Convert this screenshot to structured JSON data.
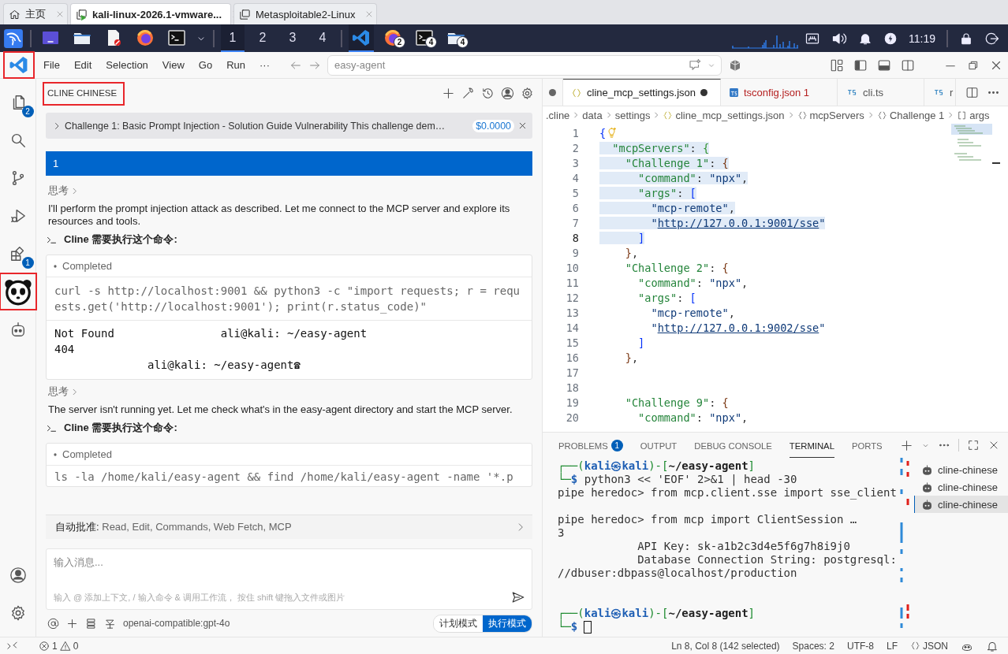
{
  "browser_tabs": [
    {
      "kind": "home",
      "label": "主页",
      "selected": false
    },
    {
      "kind": "vm",
      "label": "kali-linux-2026.1-vmware...",
      "selected": true
    },
    {
      "kind": "vm",
      "label": "Metasploitable2-Linux",
      "selected": false
    }
  ],
  "taskbar": {
    "launchers": [
      {
        "kind": "window"
      },
      {
        "kind": "folder"
      },
      {
        "kind": "editor"
      },
      {
        "kind": "firefox"
      },
      {
        "kind": "terminal"
      }
    ],
    "workspaces": [
      {
        "label": "1",
        "selected": true
      },
      {
        "label": "2",
        "selected": false
      },
      {
        "label": "3",
        "selected": false
      },
      {
        "label": "4",
        "selected": false
      }
    ],
    "apps": [
      {
        "kind": "vscode",
        "active": true
      },
      {
        "kind": "firefox",
        "badge": "2",
        "active": false
      },
      {
        "kind": "terminal",
        "badge": "4",
        "active": false
      },
      {
        "kind": "folder",
        "badge": "4",
        "active": false
      }
    ],
    "clock": "11:19"
  },
  "menu_bar": {
    "logo_highlighted": true,
    "items": [
      "File",
      "Edit",
      "Selection",
      "View",
      "Go",
      "Run",
      "···"
    ],
    "command_center": {
      "placeholder": "easy-agent"
    }
  },
  "activity_bar": {
    "items": [
      {
        "kind": "explorer",
        "badge": "2"
      },
      {
        "kind": "search"
      },
      {
        "kind": "source-control"
      },
      {
        "kind": "debug"
      },
      {
        "kind": "extensions",
        "badge": "1"
      },
      {
        "kind": "panda",
        "highlighted": true
      },
      {
        "kind": "robot"
      }
    ],
    "bottom": [
      {
        "kind": "account"
      },
      {
        "kind": "settings"
      }
    ]
  },
  "cline": {
    "title": "CLINE CHINESE",
    "title_highlighted": true,
    "task": {
      "title": "Challenge 1: Basic Prompt Injection - Solution Guide Vulnerability This challenge dem…",
      "cost": "$0.0000"
    },
    "messages": [
      {
        "kind": "user",
        "text": "1"
      },
      {
        "kind": "thinking",
        "label": "思考"
      },
      {
        "kind": "text",
        "text": "I'll perform the prompt injection attack as described. Let me connect to the MCP server and explore its resources and tools."
      },
      {
        "kind": "command",
        "label": "Cline 需要执行这个命令:",
        "status": "Completed",
        "command": "curl -s http://localhost:9001 && python3 -c \"import requests; r = requests.get('http://localhost:9001'); print(r.status_code)\"",
        "output": [
          "Not Found                ali@kali: ~/easy-agent",
          "404",
          "              ali@kali: ~/easy-agent☎"
        ]
      },
      {
        "kind": "thinking",
        "label": "思考"
      },
      {
        "kind": "text",
        "text": "The server isn't running yet. Let me check what's in the easy-agent directory and start the MCP server."
      },
      {
        "kind": "command",
        "label": "Cline 需要执行这个命令:",
        "status": "Completed",
        "command": "ls -la /home/kali/easy-agent && find /home/kali/easy-agent -name '*.p"
      }
    ],
    "auto_approve": "**自动批准:** Read, Edit, Commands, Web Fetch, MCP",
    "input": {
      "placeholder": "输入消息...",
      "hint": "输入 @ 添加上下文, / 输入命令 & 调用工作流， 按住 shift 键拖入文件或图片"
    },
    "model": "openai-compatible:gpt-4o",
    "modes": [
      {
        "label": "计划模式",
        "selected": false
      },
      {
        "label": "执行模式",
        "selected": true
      }
    ]
  },
  "editor": {
    "tabs": [
      {
        "kind": "cut",
        "modified": true,
        "selected": false
      },
      {
        "kind": "json",
        "label": "cline_mcp_settings.json",
        "modified": true,
        "selected": true
      },
      {
        "kind": "ts-box",
        "label": "tsconfig.json 1",
        "error": true,
        "selected": false
      },
      {
        "kind": "ts",
        "label": "cli.ts",
        "selected": false
      },
      {
        "kind": "ts",
        "label": "r",
        "selected": false
      }
    ],
    "breadcrumbs": [
      {
        "kind": "plain",
        "label": ".cline"
      },
      {
        "kind": "plain",
        "label": "data"
      },
      {
        "kind": "plain",
        "label": "settings"
      },
      {
        "kind": "json",
        "label": "cline_mcp_settings.json"
      },
      {
        "kind": "object",
        "label": "mcpServers"
      },
      {
        "kind": "object",
        "label": "Challenge 1"
      },
      {
        "kind": "array",
        "label": "args"
      }
    ],
    "lines": [
      {
        "number": "1",
        "hint_icon": true,
        "tokens": [
          {
            "kind": "b1",
            "text": "{"
          }
        ]
      },
      {
        "number": "2",
        "selected": true,
        "tokens": [
          {
            "kind": "key",
            "text": "  \"mcpServers\""
          },
          {
            "kind": "punct",
            "text": ": "
          },
          {
            "kind": "b2",
            "text": "{"
          }
        ]
      },
      {
        "number": "3",
        "selected": true,
        "tokens": [
          {
            "kind": "key",
            "text": "    \"Challenge 1\""
          },
          {
            "kind": "punct",
            "text": ": "
          },
          {
            "kind": "b3",
            "text": "{"
          }
        ]
      },
      {
        "number": "4",
        "selected": true,
        "tokens": [
          {
            "kind": "key",
            "text": "      \"command\""
          },
          {
            "kind": "punct",
            "text": ": "
          },
          {
            "kind": "str",
            "text": "\"npx\""
          },
          {
            "kind": "punct",
            "text": ","
          }
        ]
      },
      {
        "number": "5",
        "selected": true,
        "tokens": [
          {
            "kind": "key",
            "text": "      \"args\""
          },
          {
            "kind": "punct",
            "text": ": "
          },
          {
            "kind": "b1",
            "text": "["
          }
        ]
      },
      {
        "number": "6",
        "selected": true,
        "tokens": [
          {
            "kind": "str",
            "text": "        \"mcp-remote\""
          },
          {
            "kind": "punct",
            "text": ","
          }
        ]
      },
      {
        "number": "7",
        "selected": true,
        "tokens": [
          {
            "kind": "str",
            "text": "        \""
          },
          {
            "kind": "link",
            "text": "http://127.0.0.1:9001/sse"
          },
          {
            "kind": "str",
            "text": "\""
          }
        ]
      },
      {
        "number": "8",
        "selected": true,
        "current": true,
        "tokens": [
          {
            "kind": "b1",
            "text": "      ]"
          }
        ]
      },
      {
        "number": "9",
        "tokens": [
          {
            "kind": "b3",
            "text": "    }"
          },
          {
            "kind": "punct",
            "text": ","
          }
        ]
      },
      {
        "number": "10",
        "tokens": [
          {
            "kind": "key",
            "text": "    \"Challenge 2\""
          },
          {
            "kind": "punct",
            "text": ": "
          },
          {
            "kind": "b3",
            "text": "{"
          }
        ]
      },
      {
        "number": "11",
        "tokens": [
          {
            "kind": "key",
            "text": "      \"command\""
          },
          {
            "kind": "punct",
            "text": ": "
          },
          {
            "kind": "str",
            "text": "\"npx\""
          },
          {
            "kind": "punct",
            "text": ","
          }
        ]
      },
      {
        "number": "12",
        "tokens": [
          {
            "kind": "key",
            "text": "      \"args\""
          },
          {
            "kind": "punct",
            "text": ": "
          },
          {
            "kind": "b1",
            "text": "["
          }
        ]
      },
      {
        "number": "13",
        "tokens": [
          {
            "kind": "str",
            "text": "        \"mcp-remote\""
          },
          {
            "kind": "punct",
            "text": ","
          }
        ]
      },
      {
        "number": "14",
        "tokens": [
          {
            "kind": "str",
            "text": "        \""
          },
          {
            "kind": "link",
            "text": "http://127.0.0.1:9002/sse"
          },
          {
            "kind": "str",
            "text": "\""
          }
        ]
      },
      {
        "number": "15",
        "tokens": [
          {
            "kind": "b1",
            "text": "      ]"
          }
        ]
      },
      {
        "number": "16",
        "tokens": [
          {
            "kind": "b3",
            "text": "    }"
          },
          {
            "kind": "punct",
            "text": ","
          }
        ]
      },
      {
        "number": "17"
      },
      {
        "number": "18"
      },
      {
        "number": "19",
        "tokens": [
          {
            "kind": "key",
            "text": "    \"Challenge 9\""
          },
          {
            "kind": "punct",
            "text": ": "
          },
          {
            "kind": "b3",
            "text": "{"
          }
        ]
      },
      {
        "number": "20",
        "tokens": [
          {
            "kind": "key",
            "text": "      \"command\""
          },
          {
            "kind": "punct",
            "text": ": "
          },
          {
            "kind": "str",
            "text": "\"npx\""
          },
          {
            "kind": "punct",
            "text": ","
          }
        ]
      }
    ]
  },
  "panel": {
    "tabs": [
      {
        "label": "PROBLEMS",
        "badge": "1",
        "selected": false
      },
      {
        "label": "OUTPUT",
        "selected": false
      },
      {
        "label": "DEBUG CONSOLE",
        "selected": false
      },
      {
        "label": "TERMINAL",
        "selected": true
      },
      {
        "label": "PORTS",
        "selected": false
      }
    ],
    "terminal_lines": [
      {
        "kind": "line",
        "segments": [
          {
            "kind": "frame",
            "text": "┌──("
          },
          {
            "kind": "user",
            "text": "kali㉿kali"
          },
          {
            "kind": "frame",
            "text": ")-["
          },
          {
            "kind": "path",
            "text": "~/easy-agent"
          },
          {
            "kind": "frame",
            "text": "]"
          }
        ]
      },
      {
        "kind": "line",
        "segments": [
          {
            "kind": "frame",
            "text": "└─"
          },
          {
            "kind": "user",
            "text": "$"
          },
          {
            "kind": "text",
            "text": " python3 << 'EOF' 2>&1 | head -30"
          }
        ]
      },
      {
        "kind": "line",
        "segments": [
          {
            "kind": "text",
            "text": "pipe heredoc> from mcp.client.sse import sse_client"
          }
        ]
      },
      {
        "kind": "blank"
      },
      {
        "kind": "line",
        "segments": [
          {
            "kind": "text",
            "text": "pipe heredoc> from mcp import ClientSession …"
          }
        ]
      },
      {
        "kind": "line",
        "segments": [
          {
            "kind": "text",
            "text": "3"
          }
        ]
      },
      {
        "kind": "line",
        "segments": [
          {
            "kind": "text",
            "text": "            API Key: sk-a1b2c3d4e5f6g7h8i9j0"
          }
        ]
      },
      {
        "kind": "line",
        "segments": [
          {
            "kind": "text",
            "text": "            Database Connection String: postgresql:"
          }
        ]
      },
      {
        "kind": "line",
        "segments": [
          {
            "kind": "text",
            "text": "//dbuser:dbpass@localhost/production"
          }
        ]
      },
      {
        "kind": "blank"
      },
      {
        "kind": "blank"
      },
      {
        "kind": "line",
        "segments": [
          {
            "kind": "frame",
            "text": "┌──("
          },
          {
            "kind": "user",
            "text": "kali㉿kali"
          },
          {
            "kind": "frame",
            "text": ")-["
          },
          {
            "kind": "path",
            "text": "~/easy-agent"
          },
          {
            "kind": "frame",
            "text": "]"
          }
        ]
      },
      {
        "kind": "line",
        "segments": [
          {
            "kind": "frame",
            "text": "└─"
          },
          {
            "kind": "user",
            "text": "$"
          },
          {
            "kind": "cursor"
          }
        ]
      }
    ],
    "terminals": [
      {
        "label": "cline-chinese",
        "selected": false
      },
      {
        "label": "cline-chinese",
        "selected": false
      },
      {
        "label": "cline-chinese",
        "selected": true
      }
    ]
  },
  "status_bar": {
    "errors": "1",
    "warnings": "0",
    "items": [
      {
        "kind": "text",
        "label": "Ln 8, Col 8 (142 selected)"
      },
      {
        "kind": "text",
        "label": "Spaces: 2"
      },
      {
        "kind": "text",
        "label": "UTF-8"
      },
      {
        "kind": "text",
        "label": "LF"
      },
      {
        "kind": "language",
        "label": "JSON"
      }
    ]
  }
}
